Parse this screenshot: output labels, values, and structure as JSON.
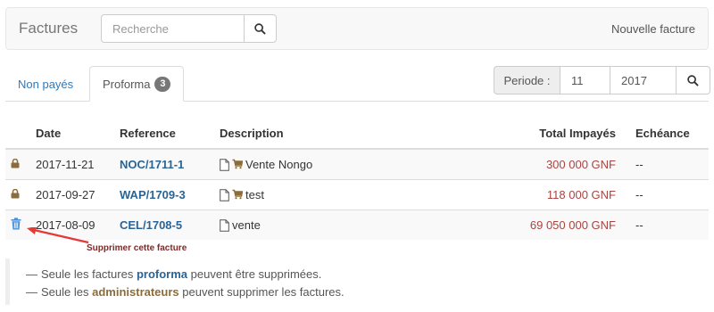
{
  "navbar": {
    "brand": "Factures",
    "search_placeholder": "Recherche",
    "new_invoice_label": "Nouvelle facture"
  },
  "tabs": {
    "unpaid": "Non payés",
    "proforma": "Proforma",
    "proforma_count": "3"
  },
  "period": {
    "label": "Periode :",
    "month": "11",
    "year": "2017"
  },
  "table": {
    "headers": {
      "date": "Date",
      "reference": "Reference",
      "description": "Description",
      "total": "Total Impayés",
      "due": "Echéance"
    },
    "rows": [
      {
        "icon": "lock-icon",
        "date": "2017-11-21",
        "reference": "NOC/1711-1",
        "description": "Vente Nongo",
        "cart": true,
        "total": "300 000 GNF",
        "due": "--"
      },
      {
        "icon": "lock-icon",
        "date": "2017-09-27",
        "reference": "WAP/1709-3",
        "description": "test",
        "cart": true,
        "total": "118 000 GNF",
        "due": "--"
      },
      {
        "icon": "trash-icon",
        "date": "2017-08-09",
        "reference": "CEL/1708-5",
        "description": "vente",
        "cart": false,
        "total": "69 050 000 GNF",
        "due": "--"
      }
    ]
  },
  "annotation": {
    "label": "Supprimer cette facture",
    "color": "#e53935"
  },
  "notes": {
    "line1_before": "Seule les factures",
    "line1_highlight": "proforma",
    "line1_after": "peuvent être supprimées.",
    "line2_before": "Seule les",
    "line2_highlight": "administrateurs",
    "line2_after": "peuvent supprimer les factures."
  },
  "colors": {
    "link": "#2a6496",
    "amount": "#a94442",
    "lock": "#8a6d3b",
    "trash": "#4a90d9"
  }
}
